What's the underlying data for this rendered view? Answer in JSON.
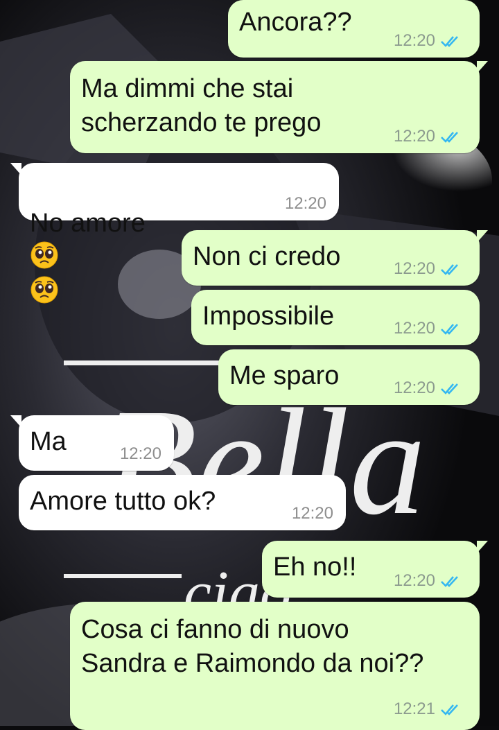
{
  "messages": [
    {
      "dir": "out",
      "text": "Ancora??",
      "time": "12:20",
      "status": "read-ticks-icon"
    },
    {
      "dir": "out",
      "text": "Ma dimmi che stai\nscherzando te prego",
      "time": "12:20",
      "status": "read-ticks-icon"
    },
    {
      "dir": "in",
      "text": "No amore",
      "emoji": [
        "pleading-face-emoji",
        "pleading-face-emoji"
      ],
      "time": "12:20"
    },
    {
      "dir": "out",
      "text": "Non ci credo",
      "time": "12:20",
      "status": "read-ticks-icon"
    },
    {
      "dir": "out",
      "text": "Impossibile",
      "time": "12:20",
      "status": "read-ticks-icon"
    },
    {
      "dir": "out",
      "text": "Me sparo",
      "time": "12:20",
      "status": "read-ticks-icon"
    },
    {
      "dir": "in",
      "text": "Ma",
      "time": "12:20"
    },
    {
      "dir": "in",
      "text": "Amore tutto ok?",
      "time": "12:20"
    },
    {
      "dir": "out",
      "text": "Eh no!!",
      "time": "12:20",
      "status": "read-ticks-icon"
    },
    {
      "dir": "out",
      "text": "Cosa ci fanno di nuovo\nSandra e Raimondo da noi??",
      "time": "12:21",
      "status": "read-ticks-icon"
    }
  ],
  "wallpaper": {
    "text_large": "Bella",
    "text_small": "ciao"
  },
  "colors": {
    "outgoing_bubble": "#e2ffc8",
    "incoming_bubble": "#ffffff",
    "read_ticks": "#34b7f1",
    "timestamp": "#8b9a8e"
  }
}
